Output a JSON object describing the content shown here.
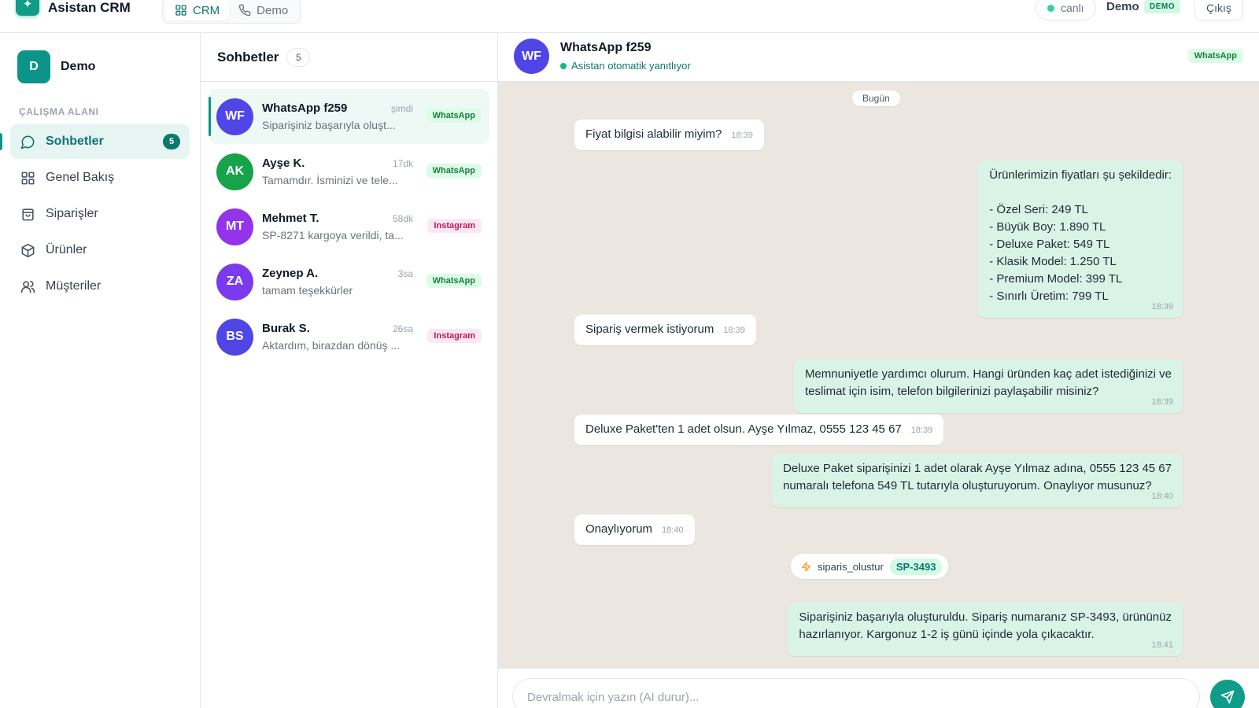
{
  "app": {
    "logo_glyph": "✦",
    "title": "Asistan CRM"
  },
  "topnav": {
    "tabs": [
      {
        "label": "CRM",
        "icon": "grid-icon",
        "active": true
      },
      {
        "label": "Demo",
        "icon": "phone-icon",
        "active": false
      }
    ],
    "live_label": "canlı",
    "user_name": "Demo",
    "user_badge": "DEMO",
    "logout_label": "Çıkış"
  },
  "sidebar": {
    "workspace_initial": "D",
    "workspace_name": "Demo",
    "section_label": "ÇALIŞMA ALANI",
    "items": [
      {
        "label": "Sohbetler",
        "icon": "chat-bubble-icon",
        "count": "5",
        "active": true
      },
      {
        "label": "Genel Bakış",
        "icon": "grid-icon"
      },
      {
        "label": "Siparişler",
        "icon": "shopping-bag-icon"
      },
      {
        "label": "Ürünler",
        "icon": "box-icon"
      },
      {
        "label": "Müşteriler",
        "icon": "users-icon"
      }
    ]
  },
  "conversations": {
    "title": "Sohbetler",
    "count": "5",
    "items": [
      {
        "initials": "WF",
        "name": "WhatsApp f259",
        "time": "şimdi",
        "preview": "Siparişiniz başarıyla oluşt...",
        "channel": "WhatsApp",
        "avatar_color": "#4f46e5"
      },
      {
        "initials": "AK",
        "name": "Ayşe K.",
        "time": "17dk",
        "preview": "Tamamdır. İsminizi ve tele...",
        "channel": "WhatsApp",
        "avatar_color": "#16a34a"
      },
      {
        "initials": "MT",
        "name": "Mehmet T.",
        "time": "58dk",
        "preview": "SP-8271 kargoya verildi, ta...",
        "channel": "Instagram",
        "avatar_color": "#9333ea"
      },
      {
        "initials": "ZA",
        "name": "Zeynep A.",
        "time": "3sa",
        "preview": "tamam teşekkürler",
        "channel": "WhatsApp",
        "avatar_color": "#7c3aed"
      },
      {
        "initials": "BS",
        "name": "Burak S.",
        "time": "26sa",
        "preview": "Aktardım, birazdan dönüş ...",
        "channel": "Instagram",
        "avatar_color": "#4f46e5"
      }
    ]
  },
  "chat": {
    "initials": "WF",
    "name": "WhatsApp f259",
    "status": "Asistan otomatik yanıtlıyor",
    "channel": "WhatsApp",
    "day_label": "Bugün",
    "messages": [
      {
        "dir": "in",
        "text": "Fiyat bilgisi alabilir miyim?",
        "time": "18:39"
      },
      {
        "dir": "out",
        "text": "Ürünlerimizin fiyatları şu şekildedir:\n\n- Özel Seri: 249 TL\n- Büyük Boy: 1.890 TL\n- Deluxe Paket: 549 TL\n- Klasik Model: 1.250 TL\n- Premium Model: 399 TL\n- Sınırlı Üretim: 799 TL",
        "time": "18:39"
      },
      {
        "dir": "in",
        "text": "Sipariş vermek istiyorum",
        "time": "18:39"
      },
      {
        "dir": "out",
        "text": "Memnuniyetle yardımcı olurum. Hangi üründen kaç adet istediğinizi ve\nteslimat için isim, telefon bilgilerinizi paylaşabilir misiniz?",
        "time": "18:39"
      },
      {
        "dir": "in",
        "text": "Deluxe Paket'ten 1 adet olsun. Ayşe Yılmaz, 0555 123 45 67",
        "time": "18:39"
      },
      {
        "dir": "out",
        "text": "Deluxe Paket siparişinizi 1 adet olarak Ayşe Yılmaz adına, 0555 123 45 67\nnumaralı telefona 549 TL tutarıyla oluşturuyorum. Onaylıyor musunuz?",
        "time": "18:40"
      },
      {
        "dir": "in",
        "text": "Onaylıyorum",
        "time": "18:40"
      },
      {
        "dir": "out",
        "text": "Siparişiniz başarıyla oluşturuldu. Sipariş numaranız SP-3493, ürününüz\nhazırlanıyor. Kargonuz 1-2 iş günü içinde yola çıkacaktır.",
        "time": "18:41"
      }
    ],
    "tool_call": {
      "icon": "lightning-icon",
      "name": "siparis_olustur",
      "ref": "SP-3493"
    },
    "composer_placeholder": "Devralmak için yazın (AI durur)...",
    "send_icon": "send-icon"
  },
  "colors": {
    "accent": "#0f9d8a",
    "chat_bg": "#ebe6df",
    "outgoing_bubble": "#d9f4e6",
    "incoming_bubble": "#ffffff"
  }
}
